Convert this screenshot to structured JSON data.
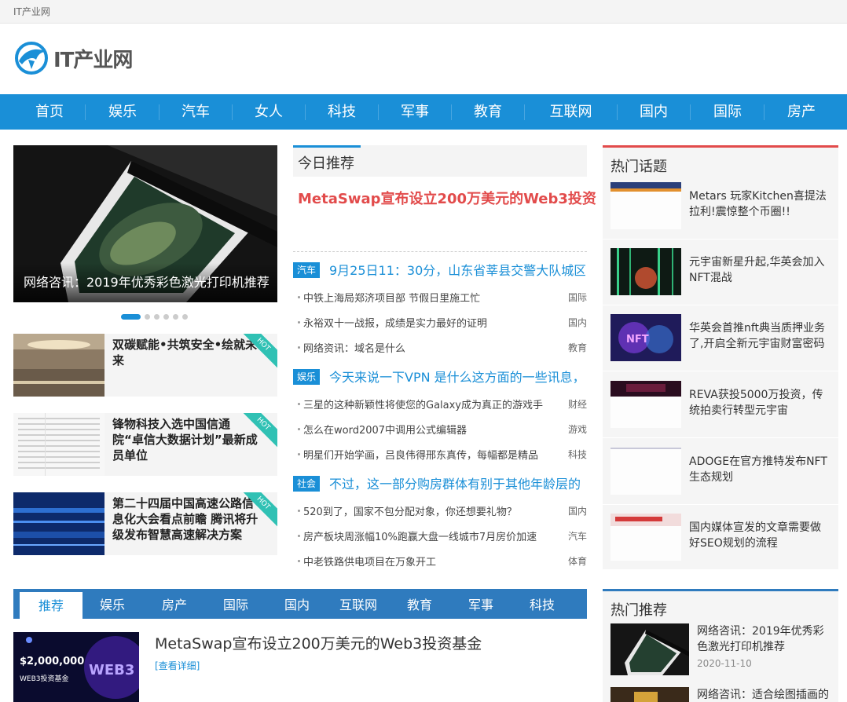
{
  "site": {
    "top_title": "IT产业网",
    "logo_text": "IT产业网"
  },
  "colors": {
    "nav": "#1a8fd7",
    "accent_red": "#e24b4b",
    "badge": "#30c1b4",
    "tabs": "#2f7bbe"
  },
  "nav": [
    "首页",
    "娱乐",
    "汽车",
    "女人",
    "科技",
    "军事",
    "教育",
    "互联网",
    "国内",
    "国际",
    "房产"
  ],
  "slider": {
    "caption": "网络咨讯：2019年优秀彩色激光打印机推荐",
    "dots_total": 7,
    "active_dot": 1
  },
  "hot_items": [
    {
      "title": "双碳赋能•共筑安全•绘就未来",
      "badge": "HOT"
    },
    {
      "title": "锋物科技入选中国信通院“卓信大数据计划”最新成员单位",
      "badge": "HOT"
    },
    {
      "title": "第二十四届中国高速公路信息化大会看点前瞻 腾讯将升级发布智慧高速解决方案",
      "badge": "HOT"
    }
  ],
  "today": {
    "heading": "今日推荐",
    "headline": "MetaSwap宣布设立200万美元的Web3投资",
    "groups": [
      {
        "tag": "汽车",
        "lead": "9月25日11：30分，山东省莘县交警大队城区",
        "items": [
          {
            "title": "中铁上海局郑济项目部 节假日里施工忙",
            "cat": "国际"
          },
          {
            "title": "永裕双十一战报，成绩是实力最好的证明",
            "cat": "国内"
          },
          {
            "title": "网络资讯：域名是什么",
            "cat": "教育"
          }
        ]
      },
      {
        "tag": "娱乐",
        "lead": "今天来说一下VPN 是什么这方面的一些讯息，",
        "items": [
          {
            "title": "三星的这种新颖性将使您的Galaxy成为真正的游戏手",
            "cat": "财经"
          },
          {
            "title": "怎么在word2007中调用公式编辑器",
            "cat": "游戏"
          },
          {
            "title": "明星们开始学画，吕良伟得邢东真传，每幅都是精品",
            "cat": "科技"
          }
        ]
      },
      {
        "tag": "社会",
        "lead": "不过，这一部分购房群体有别于其他年龄层的",
        "items": [
          {
            "title": "520到了，国家不包分配对象，你还想要礼物？",
            "cat": "国内"
          },
          {
            "title": "房产板块周涨幅10%跑赢大盘一线城市7月房价加速",
            "cat": "汽车"
          },
          {
            "title": "中老铁路供电项目在万象开工",
            "cat": "体育"
          }
        ]
      }
    ]
  },
  "hot_topics": {
    "heading": "热门话题",
    "items": [
      "Metars 玩家Kitchen喜提法拉利!震惊整个币圈!!",
      "元宇宙新星升起,华英会加入NFT混战",
      "华英会首推nft典当质押业务了,开启全新元宇宙财富密码",
      "REVA获投5000万投资，传统拍卖行转型元宇宙",
      "ADOGE在官方推特发布NFT生态规划",
      "国内媒体宣发的文章需要做好SEO规划的流程"
    ]
  },
  "tabs": [
    "推荐",
    "娱乐",
    "房产",
    "国际",
    "国内",
    "互联网",
    "教育",
    "军事",
    "科技"
  ],
  "article": {
    "title": "MetaSwap宣布设立200万美元的Web3投资基金",
    "more": "[查看详细]",
    "thumb_amount": "$2,000,000",
    "thumb_caption": "WEB3投资基金",
    "thumb_big": "WEB3"
  },
  "hot_rec": {
    "heading": "热门推荐",
    "items": [
      {
        "title": "网络咨讯：2019年优秀彩色激光打印机推荐",
        "date": "2020-11-10"
      },
      {
        "title": "网络咨讯：适合绘图插画的",
        "date": ""
      }
    ]
  }
}
